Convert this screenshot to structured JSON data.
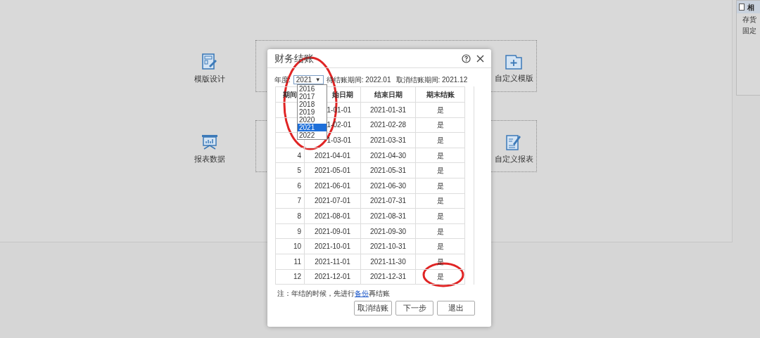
{
  "background": {
    "left_tiles": [
      {
        "label": "模版设计"
      },
      {
        "label": "报表数据"
      }
    ],
    "right_tiles": [
      {
        "label": "自定义模版"
      },
      {
        "label": "自定义报表"
      }
    ],
    "side_panel": {
      "title": "相",
      "items": [
        "存货",
        "固定"
      ]
    }
  },
  "dialog": {
    "title": "财务结账",
    "year_label": "年度:",
    "year_value": "2021",
    "year_caret": "▼",
    "pending_period": "待结账期间: 2022.01",
    "cancel_period": "取消结账期间: 2021.12",
    "year_options": [
      {
        "label": "2016",
        "selected": false
      },
      {
        "label": "2017",
        "selected": false
      },
      {
        "label": "2018",
        "selected": false
      },
      {
        "label": "2019",
        "selected": false
      },
      {
        "label": "2020",
        "selected": false
      },
      {
        "label": "2021",
        "selected": true
      },
      {
        "label": "2022",
        "selected": false
      }
    ],
    "columns": [
      "期间",
      "始日期",
      "结束日期",
      "期末结账"
    ],
    "rows": [
      {
        "start": "1-01-01",
        "end": "2021-01-31",
        "closed": "是"
      },
      {
        "start": "1-02-01",
        "end": "2021-02-28",
        "closed": "是"
      },
      {
        "start": "1-03-01",
        "end": "2021-03-31",
        "closed": "是"
      },
      {
        "period": "4",
        "start": "2021-04-01",
        "end": "2021-04-30",
        "closed": "是"
      },
      {
        "period": "5",
        "start": "2021-05-01",
        "end": "2021-05-31",
        "closed": "是"
      },
      {
        "period": "6",
        "start": "2021-06-01",
        "end": "2021-06-30",
        "closed": "是"
      },
      {
        "period": "7",
        "start": "2021-07-01",
        "end": "2021-07-31",
        "closed": "是"
      },
      {
        "period": "8",
        "start": "2021-08-01",
        "end": "2021-08-31",
        "closed": "是"
      },
      {
        "period": "9",
        "start": "2021-09-01",
        "end": "2021-09-30",
        "closed": "是"
      },
      {
        "period": "10",
        "start": "2021-10-01",
        "end": "2021-10-31",
        "closed": "是"
      },
      {
        "period": "11",
        "start": "2021-11-01",
        "end": "2021-11-30",
        "closed": "是"
      },
      {
        "period": "12",
        "start": "2021-12-01",
        "end": "2021-12-31",
        "closed": "是"
      }
    ],
    "note_prefix": "注：年结的时候，先进行",
    "note_link": "备份",
    "note_suffix": "再结账",
    "buttons": [
      "取消结账",
      "下一步",
      "退出"
    ]
  }
}
